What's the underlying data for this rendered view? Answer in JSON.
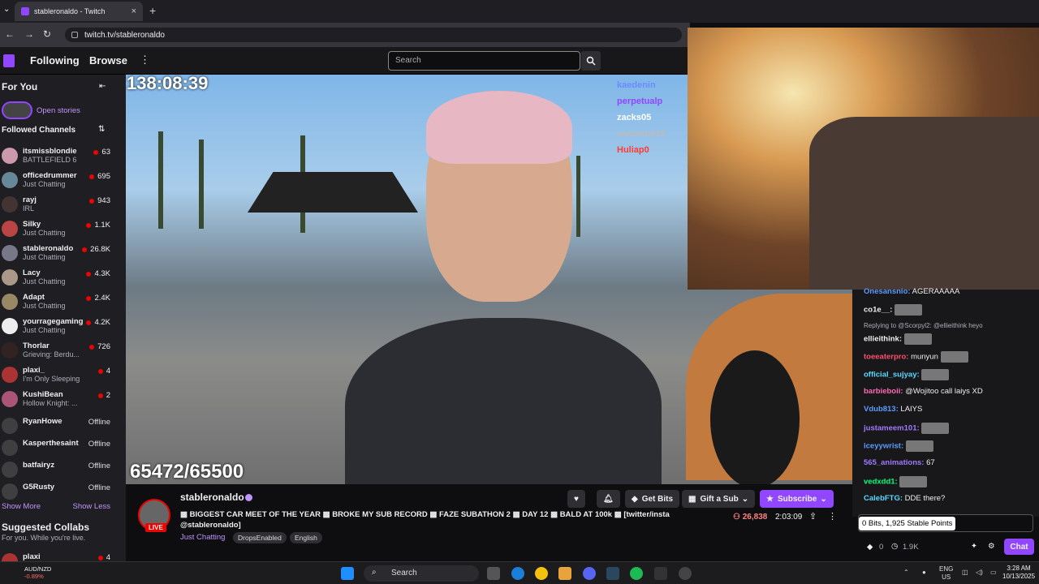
{
  "browser": {
    "tab_title": "stableronaldo - Twitch",
    "tab_close": "×",
    "new_tab": "+",
    "url": "twitch.tv/stableronaldo",
    "back": "←",
    "forward": "→",
    "reload": "↻"
  },
  "twitch_nav": {
    "following": "Following",
    "browse": "Browse",
    "more": "⋮",
    "search_placeholder": "Search"
  },
  "sidebar": {
    "header": "For You",
    "collapse": "⇤",
    "stories_label": "Open stories",
    "followed_header": "Followed Channels",
    "sort": "⇅",
    "channels": [
      {
        "name": "itsmissblondie",
        "game": "BATTLEFIELD 6",
        "viewers": "63"
      },
      {
        "name": "officedrummer",
        "game": "Just Chatting",
        "viewers": "695"
      },
      {
        "name": "rayj",
        "game": "IRL",
        "viewers": "943"
      },
      {
        "name": "Silky",
        "game": "Just Chatting",
        "viewers": "1.1K"
      },
      {
        "name": "stableronaldo",
        "game": "Just Chatting",
        "viewers": "26.8K"
      },
      {
        "name": "Lacy",
        "game": "Just Chatting",
        "viewers": "4.3K"
      },
      {
        "name": "Adapt",
        "game": "Just Chatting",
        "viewers": "2.4K"
      },
      {
        "name": "yourragegaming",
        "game": "Just Chatting",
        "viewers": "4.2K"
      },
      {
        "name": "Thorlar",
        "game": "Grieving: Berdu...",
        "viewers": "726"
      },
      {
        "name": "plaxi_",
        "game": "I'm Only Sleeping",
        "viewers": "4"
      },
      {
        "name": "KushiBean",
        "game": "Hollow Knight: ...",
        "viewers": "2"
      }
    ],
    "offline": [
      {
        "name": "RyanHowe",
        "status": "Offline"
      },
      {
        "name": "Kasperthesaint",
        "status": "Offline"
      },
      {
        "name": "batfairyz",
        "status": "Offline"
      },
      {
        "name": "G5Rusty",
        "status": "Offline"
      }
    ],
    "show_more": "Show More",
    "show_less": "Show Less",
    "suggested_header": "Suggested Collabs",
    "suggested_sub": "For you. While you're live.",
    "suggested_channel": "plaxi",
    "suggested_viewers": "4"
  },
  "video": {
    "timer": "138:08:39",
    "sub_goal": "65472/65500",
    "overlay_chat": [
      "kaedenin",
      "perpetualp",
      "zacks05",
      "samsena19",
      "Huliap0"
    ]
  },
  "chat": {
    "messages": [
      {
        "user": "Onesansnio:",
        "text": "AGERAAAAA",
        "color": "#5b9bff"
      },
      {
        "user": "co1e__:",
        "text": "",
        "color": "#ffffff",
        "emote": true
      },
      {
        "user": "Replying to @Scorpyl2: @ellieithink heyo",
        "text": "",
        "color": "#adadb8"
      },
      {
        "user": "ellieithink:",
        "text": "",
        "color": "#ffffff",
        "emote": true
      },
      {
        "user": "toeeaterpro:",
        "text": "munyun",
        "color": "#ff4d6d",
        "emote": true
      },
      {
        "user": "official_sujyay:",
        "text": "",
        "color": "#5bd8ff",
        "emote": true
      },
      {
        "user": "barbieboii:",
        "text": "@Wojitoo call laiys XD",
        "color": "#ff69b4"
      },
      {
        "user": "Vdub813:",
        "text": "LAIYS",
        "color": "#5b9bff"
      },
      {
        "user": "justameem101:",
        "text": "",
        "color": "#9f7aff",
        "emote": true
      },
      {
        "user": "iceyywrist:",
        "text": "",
        "color": "#5b9bff",
        "emote": true
      },
      {
        "user": "565_animations:",
        "text": "67",
        "color": "#9f7aff"
      },
      {
        "user": "vedxdd1:",
        "text": "",
        "color": "#00ff7f",
        "emote": true
      },
      {
        "user": "CalebFTG:",
        "text": "DDE there?",
        "color": "#5bd8ff"
      }
    ],
    "points_tooltip": "0 Bits, 1,925 Stable Points",
    "bits": "0",
    "points": "1.9K",
    "chat_button": "Chat"
  },
  "stream_info": {
    "streamer": "stableronaldo",
    "live_badge": "LIVE",
    "title": "▩ BIGGEST CAR MEET OF THE YEAR ▩ BROKE MY SUB RECORD ▩ FAZE SUBATHON 2 ▩ DAY 12 ▩ BALD AT 100k ▩ [twitter/insta @stableronaldo]",
    "category": "Just Chatting",
    "tags": [
      "DropsEnabled",
      "English"
    ],
    "viewers": "26,838",
    "uptime": "2:03:09",
    "get_bits": "Get Bits",
    "gift_sub": "Gift a Sub",
    "subscribe": "Subscribe"
  },
  "taskbar": {
    "ticker_pair": "AUD/NZD",
    "ticker_change": "-0.89%",
    "search": "Search",
    "lang": "ENG",
    "region": "US",
    "time": "3:28 AM",
    "date": "10/13/2025"
  },
  "colors": {
    "twitch_purple": "#9146ff",
    "live_red": "#eb0400"
  }
}
